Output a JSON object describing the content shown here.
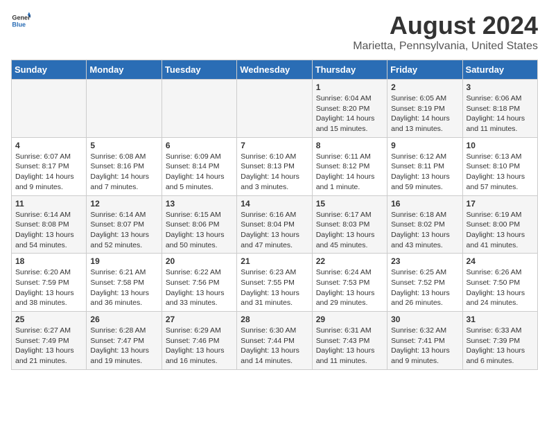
{
  "header": {
    "logo_general": "General",
    "logo_blue": "Blue",
    "main_title": "August 2024",
    "subtitle": "Marietta, Pennsylvania, United States"
  },
  "days_of_week": [
    "Sunday",
    "Monday",
    "Tuesday",
    "Wednesday",
    "Thursday",
    "Friday",
    "Saturday"
  ],
  "weeks": [
    [
      {
        "day": "",
        "info": ""
      },
      {
        "day": "",
        "info": ""
      },
      {
        "day": "",
        "info": ""
      },
      {
        "day": "",
        "info": ""
      },
      {
        "day": "1",
        "info": "Sunrise: 6:04 AM\nSunset: 8:20 PM\nDaylight: 14 hours and 15 minutes."
      },
      {
        "day": "2",
        "info": "Sunrise: 6:05 AM\nSunset: 8:19 PM\nDaylight: 14 hours and 13 minutes."
      },
      {
        "day": "3",
        "info": "Sunrise: 6:06 AM\nSunset: 8:18 PM\nDaylight: 14 hours and 11 minutes."
      }
    ],
    [
      {
        "day": "4",
        "info": "Sunrise: 6:07 AM\nSunset: 8:17 PM\nDaylight: 14 hours and 9 minutes."
      },
      {
        "day": "5",
        "info": "Sunrise: 6:08 AM\nSunset: 8:16 PM\nDaylight: 14 hours and 7 minutes."
      },
      {
        "day": "6",
        "info": "Sunrise: 6:09 AM\nSunset: 8:14 PM\nDaylight: 14 hours and 5 minutes."
      },
      {
        "day": "7",
        "info": "Sunrise: 6:10 AM\nSunset: 8:13 PM\nDaylight: 14 hours and 3 minutes."
      },
      {
        "day": "8",
        "info": "Sunrise: 6:11 AM\nSunset: 8:12 PM\nDaylight: 14 hours and 1 minute."
      },
      {
        "day": "9",
        "info": "Sunrise: 6:12 AM\nSunset: 8:11 PM\nDaylight: 13 hours and 59 minutes."
      },
      {
        "day": "10",
        "info": "Sunrise: 6:13 AM\nSunset: 8:10 PM\nDaylight: 13 hours and 57 minutes."
      }
    ],
    [
      {
        "day": "11",
        "info": "Sunrise: 6:14 AM\nSunset: 8:08 PM\nDaylight: 13 hours and 54 minutes."
      },
      {
        "day": "12",
        "info": "Sunrise: 6:14 AM\nSunset: 8:07 PM\nDaylight: 13 hours and 52 minutes."
      },
      {
        "day": "13",
        "info": "Sunrise: 6:15 AM\nSunset: 8:06 PM\nDaylight: 13 hours and 50 minutes."
      },
      {
        "day": "14",
        "info": "Sunrise: 6:16 AM\nSunset: 8:04 PM\nDaylight: 13 hours and 47 minutes."
      },
      {
        "day": "15",
        "info": "Sunrise: 6:17 AM\nSunset: 8:03 PM\nDaylight: 13 hours and 45 minutes."
      },
      {
        "day": "16",
        "info": "Sunrise: 6:18 AM\nSunset: 8:02 PM\nDaylight: 13 hours and 43 minutes."
      },
      {
        "day": "17",
        "info": "Sunrise: 6:19 AM\nSunset: 8:00 PM\nDaylight: 13 hours and 41 minutes."
      }
    ],
    [
      {
        "day": "18",
        "info": "Sunrise: 6:20 AM\nSunset: 7:59 PM\nDaylight: 13 hours and 38 minutes."
      },
      {
        "day": "19",
        "info": "Sunrise: 6:21 AM\nSunset: 7:58 PM\nDaylight: 13 hours and 36 minutes."
      },
      {
        "day": "20",
        "info": "Sunrise: 6:22 AM\nSunset: 7:56 PM\nDaylight: 13 hours and 33 minutes."
      },
      {
        "day": "21",
        "info": "Sunrise: 6:23 AM\nSunset: 7:55 PM\nDaylight: 13 hours and 31 minutes."
      },
      {
        "day": "22",
        "info": "Sunrise: 6:24 AM\nSunset: 7:53 PM\nDaylight: 13 hours and 29 minutes."
      },
      {
        "day": "23",
        "info": "Sunrise: 6:25 AM\nSunset: 7:52 PM\nDaylight: 13 hours and 26 minutes."
      },
      {
        "day": "24",
        "info": "Sunrise: 6:26 AM\nSunset: 7:50 PM\nDaylight: 13 hours and 24 minutes."
      }
    ],
    [
      {
        "day": "25",
        "info": "Sunrise: 6:27 AM\nSunset: 7:49 PM\nDaylight: 13 hours and 21 minutes."
      },
      {
        "day": "26",
        "info": "Sunrise: 6:28 AM\nSunset: 7:47 PM\nDaylight: 13 hours and 19 minutes."
      },
      {
        "day": "27",
        "info": "Sunrise: 6:29 AM\nSunset: 7:46 PM\nDaylight: 13 hours and 16 minutes."
      },
      {
        "day": "28",
        "info": "Sunrise: 6:30 AM\nSunset: 7:44 PM\nDaylight: 13 hours and 14 minutes."
      },
      {
        "day": "29",
        "info": "Sunrise: 6:31 AM\nSunset: 7:43 PM\nDaylight: 13 hours and 11 minutes."
      },
      {
        "day": "30",
        "info": "Sunrise: 6:32 AM\nSunset: 7:41 PM\nDaylight: 13 hours and 9 minutes."
      },
      {
        "day": "31",
        "info": "Sunrise: 6:33 AM\nSunset: 7:39 PM\nDaylight: 13 hours and 6 minutes."
      }
    ]
  ]
}
